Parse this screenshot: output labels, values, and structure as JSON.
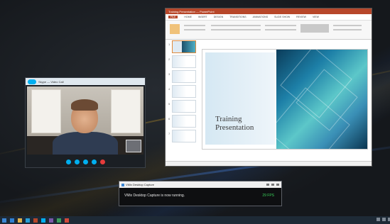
{
  "skype": {
    "title": "Skype — Video Call",
    "icon": "skype-logo-icon"
  },
  "powerpoint": {
    "window_title": "Training Presentation — PowerPoint",
    "tabs": [
      "FILE",
      "HOME",
      "INSERT",
      "DESIGN",
      "TRANSITIONS",
      "ANIMATIONS",
      "SLIDE SHOW",
      "REVIEW",
      "VIEW"
    ],
    "slide_numbers": [
      "1",
      "2",
      "3",
      "4",
      "5",
      "6",
      "7"
    ],
    "slide_title_line1": "Training",
    "slide_title_line2": "Presentation"
  },
  "capture": {
    "title": "VMix Desktop Capture",
    "message": "VMix Desktop Capture is now running.",
    "fps": "29 FPS"
  },
  "colors": {
    "ppt_accent": "#b7472a",
    "skype_blue": "#00aff0",
    "fps_green": "#39d05a"
  }
}
